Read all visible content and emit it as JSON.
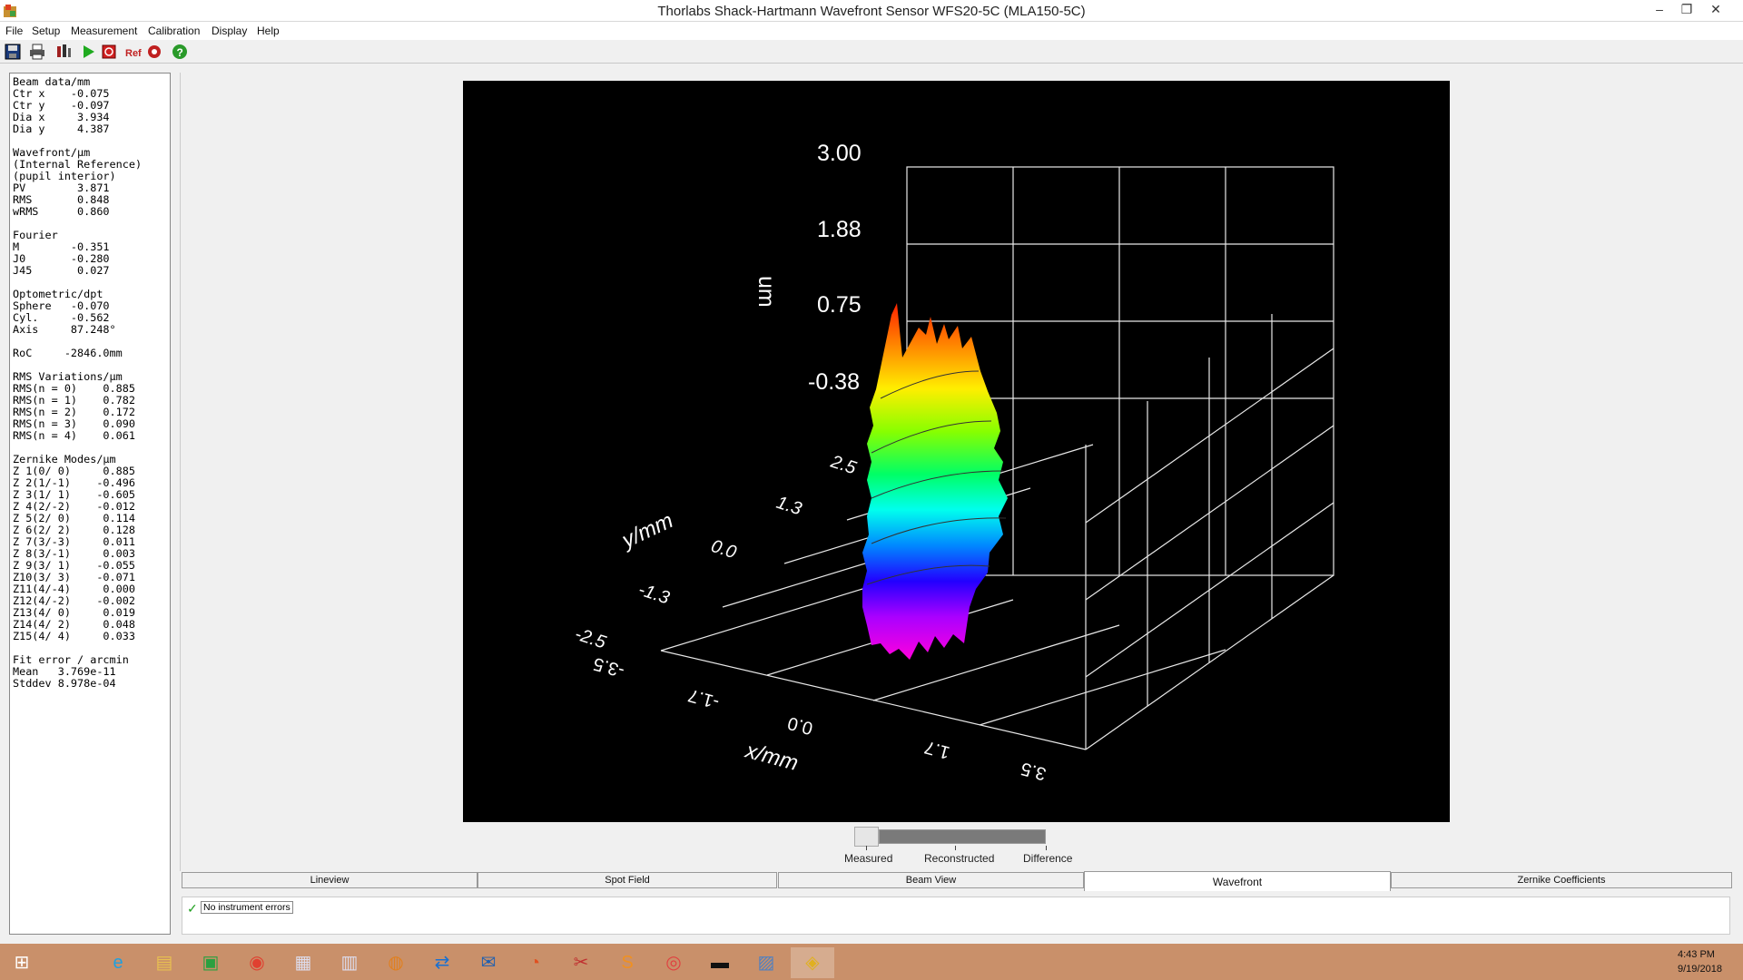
{
  "window": {
    "title": "Thorlabs Shack-Hartmann Wavefront Sensor WFS20-5C (MLA150-5C)",
    "minimize": "–",
    "restore": "❐",
    "close": "✕"
  },
  "menu": [
    "File",
    "Setup",
    "Measurement",
    "Calibration",
    "Display",
    "Help"
  ],
  "toolbar_icons": [
    "save-icon",
    "print-icon",
    "settings-icon",
    "play-icon",
    "stop-icon",
    "ref-icon",
    "calibration-icon",
    "help-icon"
  ],
  "left_panel": {
    "lines": [
      "Beam data/mm",
      "Ctr x    -0.075",
      "Ctr y    -0.097",
      "Dia x     3.934",
      "Dia y     4.387",
      "",
      "Wavefront/µm",
      "(Internal Reference)",
      "(pupil interior)",
      "PV        3.871",
      "RMS       0.848",
      "wRMS      0.860",
      "",
      "Fourier",
      "M        -0.351",
      "J0       -0.280",
      "J45       0.027",
      "",
      "Optometric/dpt",
      "Sphere   -0.070",
      "Cyl.     -0.562",
      "Axis     87.248°",
      "",
      "RoC     -2846.0mm",
      "",
      "RMS Variations/µm",
      "RMS(n = 0)    0.885",
      "RMS(n = 1)    0.782",
      "RMS(n = 2)    0.172",
      "RMS(n = 3)    0.090",
      "RMS(n = 4)    0.061",
      "",
      "Zernike Modes/µm",
      "Z 1(0/ 0)     0.885",
      "Z 2(1/-1)    -0.496",
      "Z 3(1/ 1)    -0.605",
      "Z 4(2/-2)    -0.012",
      "Z 5(2/ 0)     0.114",
      "Z 6(2/ 2)     0.128",
      "Z 7(3/-3)     0.011",
      "Z 8(3/-1)     0.003",
      "Z 9(3/ 1)    -0.055",
      "Z10(3/ 3)    -0.071",
      "Z11(4/-4)     0.000",
      "Z12(4/-2)    -0.002",
      "Z13(4/ 0)     0.019",
      "Z14(4/ 2)     0.048",
      "Z15(4/ 4)     0.033",
      "",
      "Fit error / arcmin",
      "Mean   3.769e-11",
      "Stddev 8.978e-04"
    ]
  },
  "plot": {
    "z_label": "um",
    "z_ticks": [
      "3.00",
      "1.88",
      "0.75",
      "-0.38"
    ],
    "y_label": "y/mm",
    "y_ticks": [
      "2.5",
      "1.3",
      "0.0",
      "-1.3",
      "-2.5"
    ],
    "x_label": "x/mm",
    "x_ticks": [
      "-3.5",
      "-1.7",
      "0.0",
      "1.7",
      "3.5"
    ]
  },
  "slider": {
    "labels": [
      "Measured",
      "Reconstructed",
      "Difference"
    ],
    "position": 0
  },
  "tabs": [
    "Lineview",
    "Spot Field",
    "Beam View",
    "Wavefront",
    "Zernike Coefficients"
  ],
  "active_tab": "Wavefront",
  "status": {
    "text": "No instrument errors"
  },
  "taskbar": {
    "apps": [
      "windows-start-icon",
      "internet-explorer-icon",
      "file-explorer-icon",
      "store-icon",
      "chrome-icon",
      "app-icon-1",
      "app-icon-2",
      "app-icon-3",
      "teamviewer-icon",
      "outlook-icon",
      "app-icon-4",
      "snipping-tool-icon",
      "sublime-icon",
      "app-icon-5",
      "command-prompt-icon",
      "image-viewer-icon",
      "wavefront-app-icon"
    ],
    "time": "4:43 PM",
    "date": "9/19/2018"
  }
}
